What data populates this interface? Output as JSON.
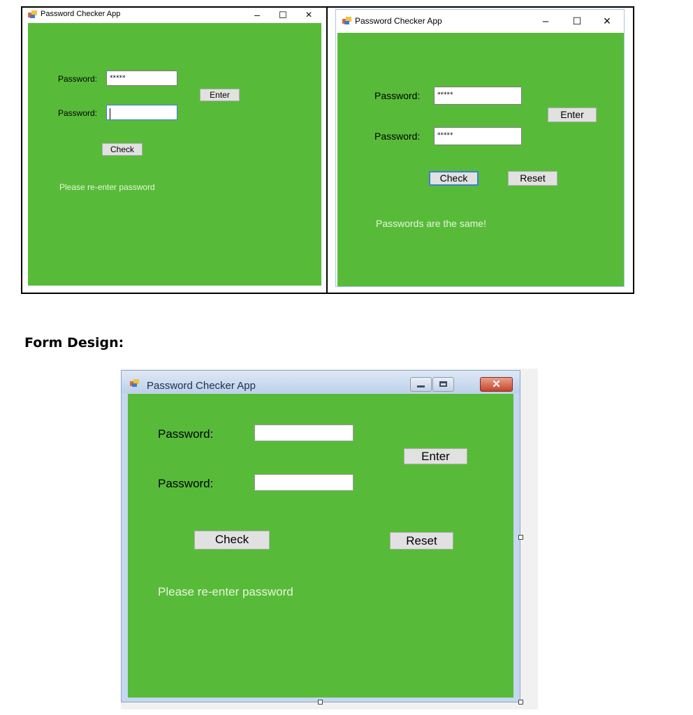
{
  "screens": [
    {
      "title": "Password Checker App",
      "controls": {
        "minimize": "–",
        "maximize": "☐",
        "close": "×"
      },
      "password1_label": "Password:",
      "password1_value": "*****",
      "password2_label": "Password:",
      "password2_value": "",
      "enter_label": "Enter",
      "check_label": "Check",
      "message": "Please re-enter password"
    },
    {
      "title": "Password Checker App",
      "controls": {
        "minimize": "–",
        "maximize": "☐",
        "close": "×"
      },
      "password1_label": "Password:",
      "password1_value": "*****",
      "password2_label": "Password:",
      "password2_value": "*****",
      "enter_label": "Enter",
      "check_label": "Check",
      "reset_label": "Reset",
      "message": "Passwords are the same!"
    }
  ],
  "section_heading": "Form Design:",
  "design": {
    "title": "Password Checker App",
    "password1_label": "Password:",
    "password2_label": "Password:",
    "enter_label": "Enter",
    "check_label": "Check",
    "reset_label": "Reset",
    "message": "Please re-enter password"
  },
  "colors": {
    "form_background": "#57bb39",
    "message_text": "#e7f7d9"
  }
}
